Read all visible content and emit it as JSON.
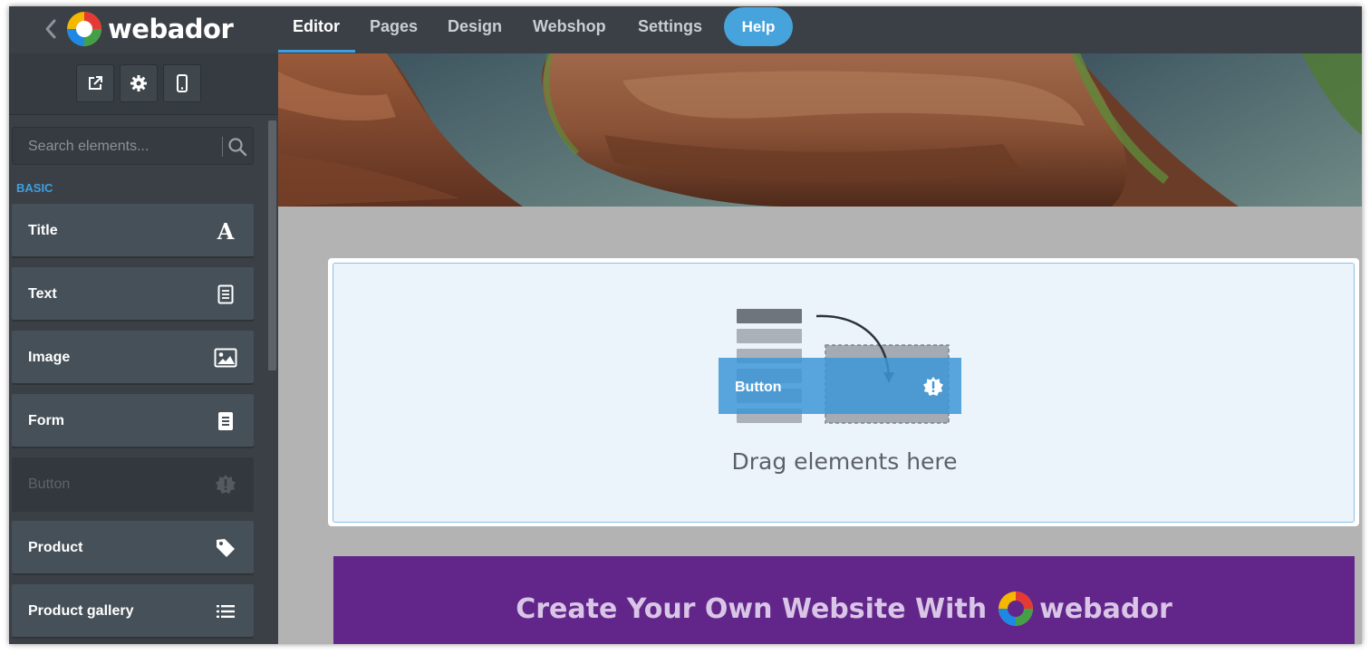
{
  "brand": {
    "name": "webador"
  },
  "nav": {
    "tabs": [
      {
        "label": "Editor",
        "active": true
      },
      {
        "label": "Pages"
      },
      {
        "label": "Design"
      },
      {
        "label": "Webshop"
      },
      {
        "label": "Settings"
      }
    ],
    "help_label": "Help"
  },
  "toolbar": {
    "buttons": [
      {
        "icon": "external-link-icon"
      },
      {
        "icon": "gear-icon"
      },
      {
        "icon": "mobile-icon"
      }
    ]
  },
  "sidebar": {
    "search_placeholder": "Search elements...",
    "section_label": "BASIC",
    "items": [
      {
        "label": "Title",
        "icon": "title-a-icon"
      },
      {
        "label": "Text",
        "icon": "text-document-icon"
      },
      {
        "label": "Image",
        "icon": "image-icon"
      },
      {
        "label": "Form",
        "icon": "form-icon"
      },
      {
        "label": "Button",
        "icon": "button-badge-icon",
        "disabled": true
      },
      {
        "label": "Product",
        "icon": "tag-icon"
      },
      {
        "label": "Product gallery",
        "icon": "list-icon"
      }
    ]
  },
  "canvas": {
    "drop_hint": "Drag elements here",
    "drag_preview_label": "Button",
    "promo_text": "Create Your Own Website With",
    "promo_brand": "webador"
  },
  "colors": {
    "topbar": "#3a4046",
    "accent": "#3fa0e0",
    "promo": "#62268a"
  }
}
